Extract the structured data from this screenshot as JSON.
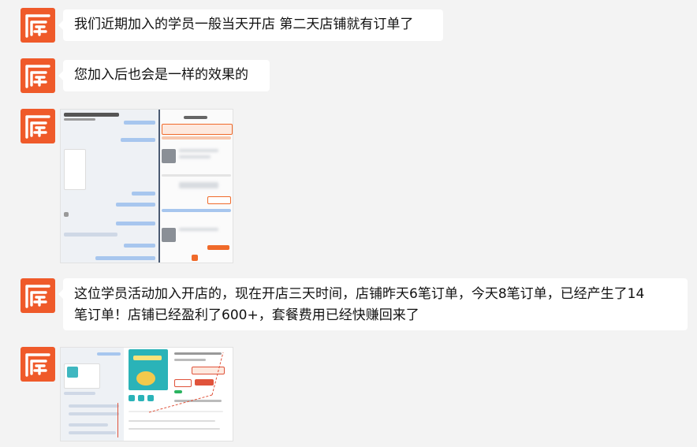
{
  "colors": {
    "avatar": "#ef5a2a",
    "bubble": "#ffffff",
    "background": "#f3f3f3",
    "accent": "#f06a2a"
  },
  "messages": [
    {
      "type": "text",
      "text": "我们近期加入的学员一般当天开店 第二天店铺就有订单了"
    },
    {
      "type": "text",
      "text": "您加入后也会是一样的效果的"
    },
    {
      "type": "image",
      "image": "chat-and-shop-orders-screenshot"
    },
    {
      "type": "text",
      "lines": [
        "这位学员活动加入开店的，现在开店三天时间，店铺昨天6笔订单，今天8笔订单，已经产生了14",
        "笔订单！店铺已经盈利了600+，套餐费用已经快赚回来了"
      ]
    },
    {
      "type": "image",
      "image": "product-listing-screenshot"
    }
  ]
}
